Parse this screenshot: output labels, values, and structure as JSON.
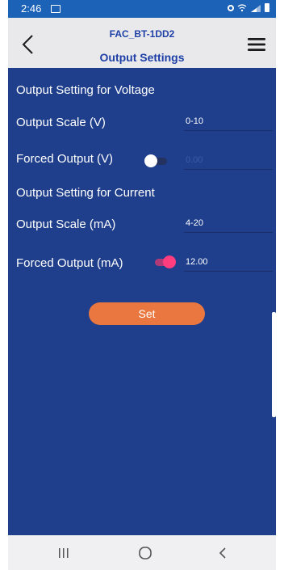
{
  "status_bar": {
    "time": "2:46"
  },
  "header": {
    "device_name": "FAC_BT-1DD2",
    "title": "Output Settings",
    "back_icon": "chevron-left-icon",
    "menu_icon": "hamburger-menu-icon"
  },
  "voltage": {
    "section_label": "Output Setting for Voltage",
    "scale_label": "Output Scale (V)",
    "scale_value": "0-10",
    "forced_label": "Forced Output (V)",
    "forced_enabled": false,
    "forced_value": "0.00"
  },
  "current": {
    "section_label": "Output Setting for Current",
    "scale_label": "Output Scale (mA)",
    "scale_value": "4-20",
    "forced_label": "Forced Output (mA)",
    "forced_enabled": true,
    "forced_value": "12.00"
  },
  "actions": {
    "set_label": "Set"
  },
  "nav": {
    "recents_icon": "recent-apps-icon",
    "home_icon": "home-icon",
    "back_icon": "back-icon"
  },
  "colors": {
    "header_background": "#e9e9ec",
    "content_background": "#1f3f8c",
    "accent_button": "#e9773f",
    "toggle_on": "#ff3d7f"
  }
}
